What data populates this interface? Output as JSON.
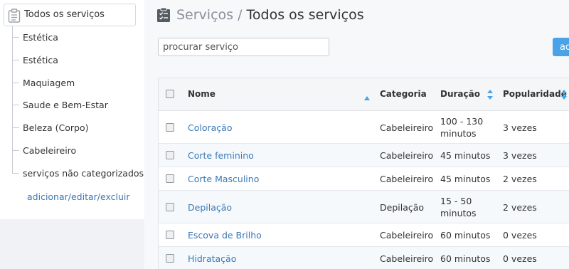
{
  "sidebar": {
    "root_label": "Todos os serviços",
    "items": [
      {
        "label": "Estética"
      },
      {
        "label": "Estética"
      },
      {
        "label": "Maquiagem"
      },
      {
        "label": "Saude e Bem-Estar"
      },
      {
        "label": "Beleza (Corpo)"
      },
      {
        "label": "Cabeleireiro"
      },
      {
        "label": "serviços não categorizados"
      }
    ],
    "manage_link": "adicionar/editar/excluir"
  },
  "header": {
    "crumb": "Serviços",
    "separator": " / ",
    "title": "Todos os serviços"
  },
  "search": {
    "placeholder": "procurar serviço",
    "value": ""
  },
  "toolbar": {
    "add_label": "ad"
  },
  "table": {
    "columns": {
      "name": "Nome",
      "category": "Categoria",
      "duration": "Duração",
      "popularity": "Popularidade"
    },
    "rows": [
      {
        "name": "Coloração",
        "category": "Cabeleireiro",
        "duration_1": "100 - 130",
        "duration_2": "minutos",
        "popularity": "3 vezes"
      },
      {
        "name": "Corte feminino",
        "category": "Cabeleireiro",
        "duration_1": "45 minutos",
        "duration_2": "",
        "popularity": "3 vezes"
      },
      {
        "name": "Corte Masculino",
        "category": "Cabeleireiro",
        "duration_1": "45 minutos",
        "duration_2": "",
        "popularity": "2 vezes"
      },
      {
        "name": "Depilação",
        "category": "Depilação",
        "duration_1": "15 - 50",
        "duration_2": "minutos",
        "popularity": "2 vezes"
      },
      {
        "name": "Escova de Brilho",
        "category": "Cabeleireiro",
        "duration_1": "60 minutos",
        "duration_2": "",
        "popularity": "0 vezes"
      },
      {
        "name": "Hidratação",
        "category": "Cabeleireiro",
        "duration_1": "60 minutos",
        "duration_2": "",
        "popularity": "0 vezes"
      }
    ]
  },
  "colors": {
    "accent": "#4aa3e6",
    "link": "#3b78b5",
    "sort_arrow": "#4aa3e6"
  },
  "icons": {
    "category_root": "clipboard-icon",
    "page_title": "clipboard-check-icon",
    "sort_name": "sort-up-icon",
    "sort_duration": "sort-both-icon",
    "sort_popularity": "sort-both-icon"
  }
}
